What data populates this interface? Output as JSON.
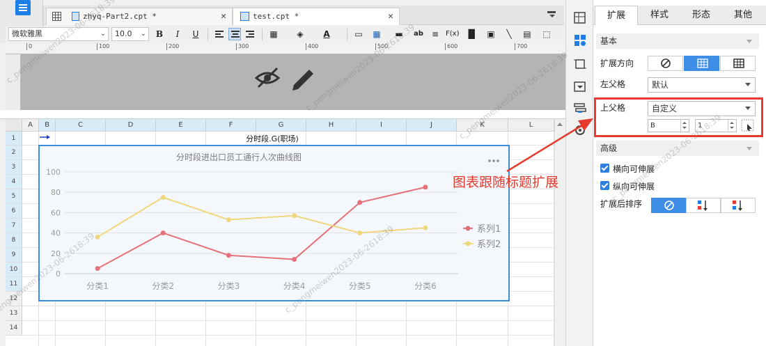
{
  "tabs": [
    {
      "label": "zhyq-Part2.cpt *",
      "icon": "grid-report-icon"
    },
    {
      "label": "test.cpt *",
      "icon": "report-file-icon"
    }
  ],
  "toolbar": {
    "font_family": "微软雅黑",
    "font_size": "10.0"
  },
  "ruler": {
    "ticks": [
      "0",
      "100",
      "200",
      "300",
      "400",
      "500",
      "600",
      "700"
    ]
  },
  "sheet": {
    "columns": [
      "A",
      "B",
      "C",
      "D",
      "E",
      "F",
      "G",
      "H",
      "I",
      "J",
      "K",
      "L"
    ],
    "rows": [
      "1",
      "2",
      "3",
      "4",
      "5",
      "6",
      "7",
      "8",
      "9",
      "10",
      "11",
      "12",
      "13",
      "14"
    ],
    "title_cell": "分时段.G(职场)"
  },
  "chart_data": {
    "type": "line",
    "title": "分时段进出口员工通行人次曲线图",
    "categories": [
      "分类1",
      "分类2",
      "分类3",
      "分类4",
      "分类5",
      "分类6"
    ],
    "series": [
      {
        "name": "系列1",
        "values": [
          5,
          40,
          18,
          14,
          70,
          85
        ],
        "color": "#e8707a"
      },
      {
        "name": "系列2",
        "values": [
          36,
          75,
          53,
          57,
          40,
          45
        ],
        "color": "#f0d77e"
      }
    ],
    "yticks": [
      "0",
      "20",
      "40",
      "60",
      "80",
      "100"
    ],
    "ylim": [
      0,
      100
    ],
    "legend": "right",
    "grid": true
  },
  "annotation": "图表跟随标题扩展",
  "panel": {
    "tabs": [
      "扩展",
      "样式",
      "形态",
      "其他"
    ],
    "basic_title": "基本",
    "expand_direction_label": "扩展方向",
    "left_parent_label": "左父格",
    "left_parent_value": "默认",
    "top_parent_label": "上父格",
    "top_parent_value": "自定义",
    "top_parent_col": "B",
    "top_parent_row": "1",
    "advanced_title": "高级",
    "horizontal_expandable": "横向可伸展",
    "vertical_expandable": "纵向可伸展",
    "sort_after_expand_label": "扩展后排序"
  },
  "watermarks": [
    "c_pengmeiwen2023-06-2618:39",
    "c_pengmeiwen2023-06-2618:39",
    "c_pengmeiwen2023-06-2618:39",
    "c_pengmeiwen2023-06-2618:39",
    "c_pengmeiwen2023-06-2618:39",
    "c_pengmeiwen2023-06-2618:39"
  ]
}
